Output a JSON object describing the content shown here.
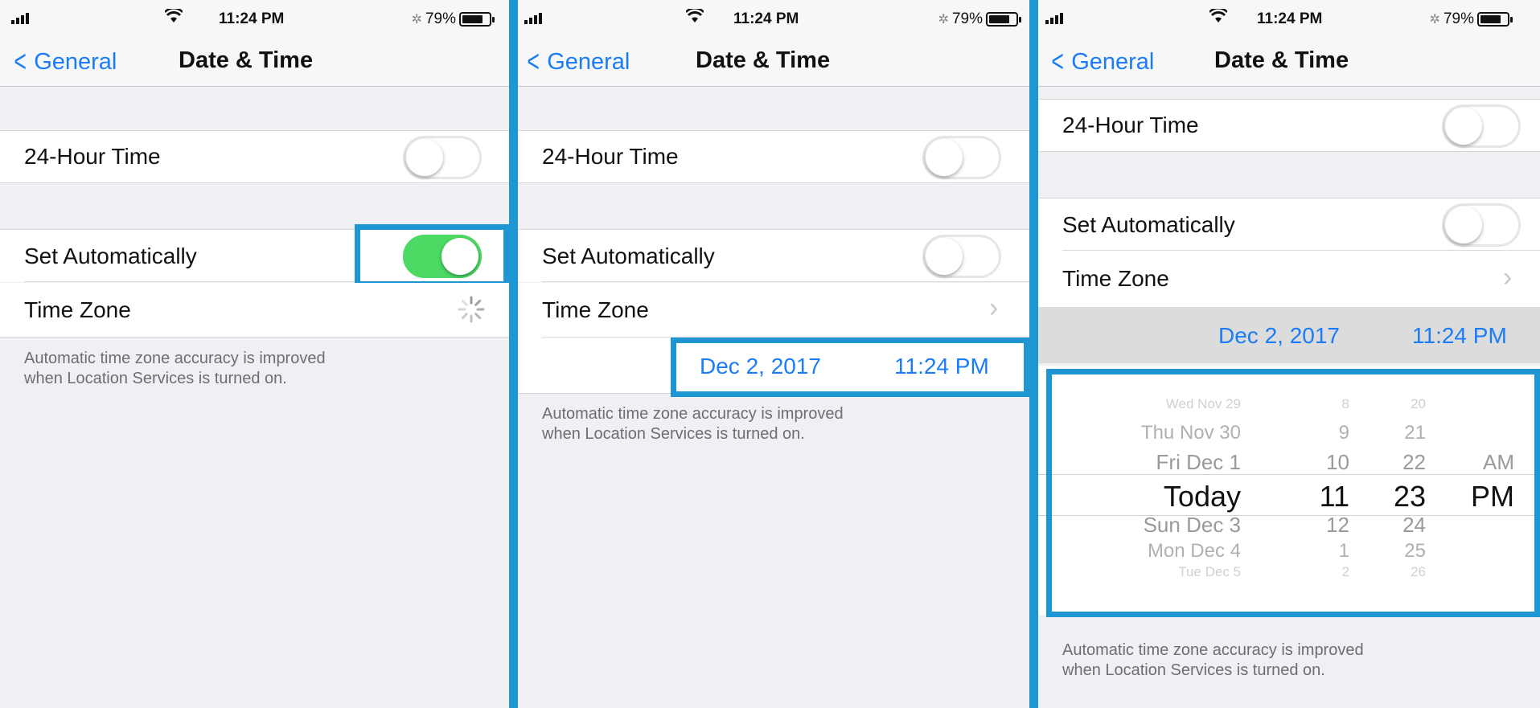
{
  "status": {
    "time": "11:24 PM",
    "battery": "79%"
  },
  "nav": {
    "back": "General",
    "title": "Date & Time"
  },
  "settings": {
    "hour24": "24-Hour Time",
    "set_auto": "Set Automatically",
    "time_zone": "Time Zone",
    "footer_line1": "Automatic time zone accuracy is improved",
    "footer_line2": "when Location Services is turned on."
  },
  "panels": [
    {
      "hour24_on": false,
      "set_auto_on": true,
      "time_zone_state": "loading"
    },
    {
      "hour24_on": false,
      "set_auto_on": false,
      "time_zone_state": "chevron",
      "date": "Dec 2, 2017",
      "time": "11:24 PM"
    },
    {
      "hour24_on": false,
      "set_auto_on": false,
      "time_zone_state": "chevron",
      "date": "Dec 2, 2017",
      "time": "11:24 PM"
    }
  ],
  "picker": {
    "rows": [
      {
        "day": "Wed Nov 29",
        "hour": "8",
        "minute": "20",
        "ampm": ""
      },
      {
        "day": "Thu Nov 30",
        "hour": "9",
        "minute": "21",
        "ampm": ""
      },
      {
        "day": "Fri Dec 1",
        "hour": "10",
        "minute": "22",
        "ampm": "AM"
      },
      {
        "day": "Today",
        "hour": "11",
        "minute": "23",
        "ampm": "PM"
      },
      {
        "day": "Sun Dec 3",
        "hour": "12",
        "minute": "24",
        "ampm": ""
      },
      {
        "day": "Mon Dec 4",
        "hour": "1",
        "minute": "25",
        "ampm": ""
      },
      {
        "day": "Tue Dec 5",
        "hour": "2",
        "minute": "26",
        "ampm": ""
      }
    ]
  },
  "colors": {
    "accent": "#1a7cf7",
    "toggle_on": "#4cd964",
    "highlight": "#1e96d2"
  },
  "icons": {
    "signal": "cellular-signal-icon",
    "wifi": "wifi-icon",
    "battery": "battery-icon",
    "back": "chevron-left-icon",
    "spinner": "activity-spinner-icon",
    "disclosure": "chevron-right-icon"
  }
}
